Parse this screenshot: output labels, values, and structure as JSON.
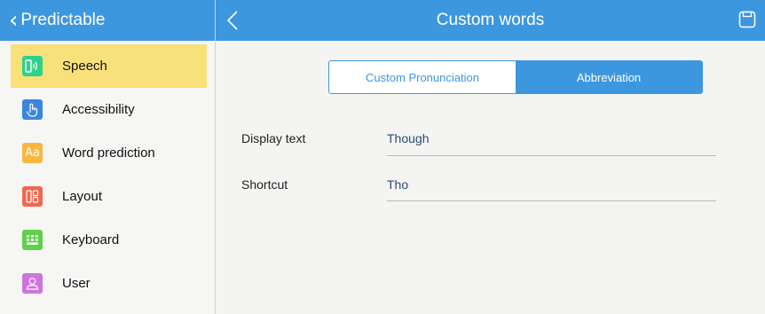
{
  "sidebar": {
    "back_label": "Predictable",
    "items": [
      {
        "label": "Speech",
        "icon": "speech-icon",
        "color": "#2fd18a",
        "active": true
      },
      {
        "label": "Accessibility",
        "icon": "touch-icon",
        "color": "#3b86e0",
        "active": false
      },
      {
        "label": "Word prediction",
        "icon": "word-prediction-icon",
        "color": "#f8b840",
        "active": false
      },
      {
        "label": "Layout",
        "icon": "layout-icon",
        "color": "#f2684f",
        "active": false
      },
      {
        "label": "Keyboard",
        "icon": "keyboard-icon",
        "color": "#5fd14c",
        "active": false
      },
      {
        "label": "User",
        "icon": "user-icon",
        "color": "#cf73de",
        "active": false
      }
    ]
  },
  "header": {
    "title": "Custom words",
    "back_icon": "chevron-left-icon",
    "save_icon": "save-icon"
  },
  "tabs": [
    {
      "label": "Custom Pronunciation",
      "selected": false
    },
    {
      "label": "Abbreviation",
      "selected": true
    }
  ],
  "form": {
    "display_text_label": "Display text",
    "display_text_value": "Though",
    "shortcut_label": "Shortcut",
    "shortcut_value": "Tho"
  },
  "colors": {
    "accent": "#3d97df",
    "active_item": "#f8e07a",
    "value_text": "#2c4c73"
  }
}
